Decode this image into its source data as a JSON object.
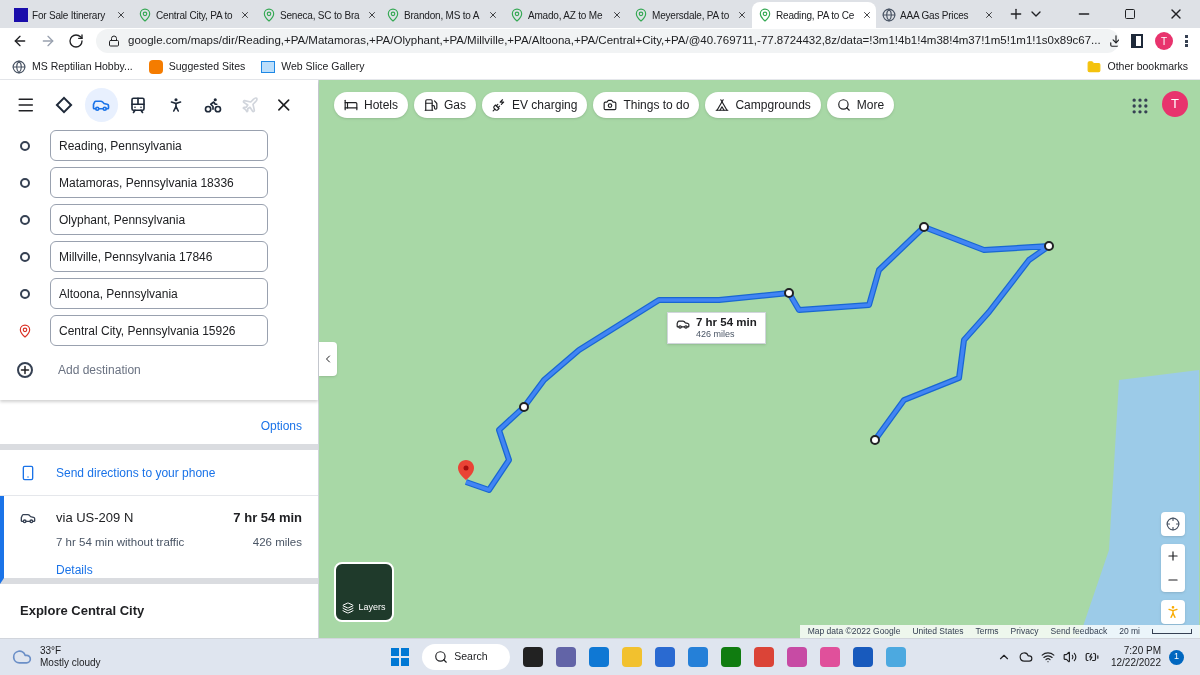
{
  "browser": {
    "tabs": [
      {
        "title": "For Sale Itinerary",
        "kind": "doc",
        "selected": false
      },
      {
        "title": "Central City, PA to",
        "kind": "maps",
        "selected": false
      },
      {
        "title": "Seneca, SC to Bra",
        "kind": "maps",
        "selected": false
      },
      {
        "title": "Brandon, MS to A",
        "kind": "maps",
        "selected": false
      },
      {
        "title": "Amado, AZ to Me",
        "kind": "maps",
        "selected": false
      },
      {
        "title": "Meyersdale, PA to",
        "kind": "maps",
        "selected": false
      },
      {
        "title": "Reading, PA to Ce",
        "kind": "maps",
        "selected": true
      },
      {
        "title": "AAA Gas Prices",
        "kind": "web",
        "selected": false
      }
    ],
    "url": "google.com/maps/dir/Reading,+PA/Matamoras,+PA/Olyphant,+PA/Millville,+PA/Altoona,+PA/Central+City,+PA/@40.769711,-77.8724432,8z/data=!3m1!4b1!4m38!4m37!1m5!1m1!1s0x89c67...",
    "profile": "T",
    "bookmarks": [
      {
        "label": "MS Reptilian Hobby...",
        "kind": "globe"
      },
      {
        "label": "Suggested Sites",
        "kind": "orange"
      },
      {
        "label": "Web Slice Gallery",
        "kind": "slice"
      }
    ],
    "other_bookmarks": "Other bookmarks"
  },
  "directions": {
    "modes": [
      {
        "kind": "best",
        "selected": false,
        "disabled": false
      },
      {
        "kind": "car",
        "selected": true,
        "disabled": false
      },
      {
        "kind": "transit",
        "selected": false,
        "disabled": false
      },
      {
        "kind": "walk",
        "selected": false,
        "disabled": false
      },
      {
        "kind": "bike",
        "selected": false,
        "disabled": false
      },
      {
        "kind": "flight",
        "selected": false,
        "disabled": true
      }
    ],
    "waypoints": [
      {
        "value": "Reading, Pennsylvania",
        "kind": "stop"
      },
      {
        "value": "Matamoras, Pennsylvania 18336",
        "kind": "stop"
      },
      {
        "value": "Olyphant, Pennsylvania",
        "kind": "stop"
      },
      {
        "value": "Millville, Pennsylvania 17846",
        "kind": "stop"
      },
      {
        "value": "Altoona, Pennsylvania",
        "kind": "stop"
      },
      {
        "value": "Central City, Pennsylvania 15926",
        "kind": "destination"
      }
    ],
    "add_destination": {
      "placeholder": "Add destination"
    },
    "options": "Options",
    "send_to_phone": "Send directions to your phone",
    "route": {
      "via": "via US-209 N",
      "time": "7 hr 54 min",
      "subtitle": "7 hr 54 min without traffic",
      "distance": "426 miles",
      "details": "Details",
      "selected": true
    },
    "explore": "Explore Central City"
  },
  "map": {
    "chips": [
      {
        "label": "Hotels",
        "kind": "bed"
      },
      {
        "label": "Gas",
        "kind": "fuel"
      },
      {
        "label": "EV charging",
        "kind": "ev"
      },
      {
        "label": "Things to do",
        "kind": "camera"
      },
      {
        "label": "Campgrounds",
        "kind": "tent"
      },
      {
        "label": "More",
        "kind": "search"
      }
    ],
    "route_label": {
      "time": "7 hr 54 min",
      "distance": "426 miles"
    },
    "profile": "T",
    "layers": "Layers",
    "footer": [
      "Map data ©2022 Google",
      "United States",
      "Terms",
      "Privacy",
      "Send feedback"
    ],
    "scale": "20 mi"
  },
  "taskbar": {
    "temperature": "33°F",
    "condition": "Mostly cloudy",
    "search": "Search",
    "time": "7:20 PM",
    "date": "12/22/2022",
    "notifications": "1"
  }
}
